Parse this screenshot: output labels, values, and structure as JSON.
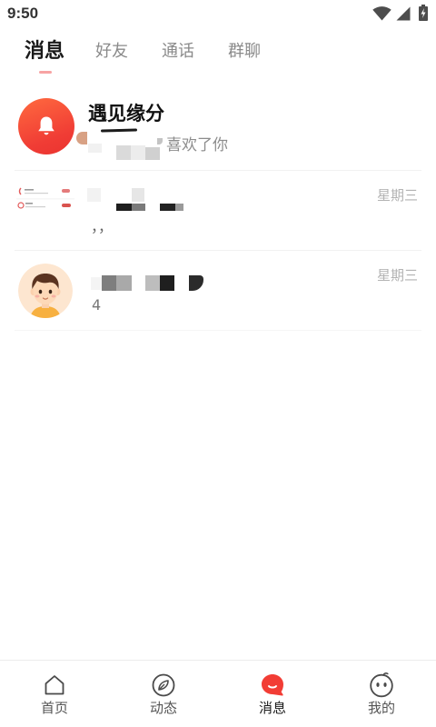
{
  "status_bar": {
    "time": "9:50",
    "icons": [
      "wifi-icon",
      "signal-icon",
      "battery-icon"
    ]
  },
  "tabs": {
    "items": [
      {
        "label": "消息",
        "active": true
      },
      {
        "label": "好友",
        "active": false
      },
      {
        "label": "通话",
        "active": false
      },
      {
        "label": "群聊",
        "active": false
      }
    ]
  },
  "conversations": [
    {
      "title": "遇见缘分",
      "preview": "喜欢了你",
      "avatar_icon": "bell-icon"
    },
    {
      "preview": "，，",
      "time": "星期三",
      "avatar_icon": "screenshot-thumbnail"
    },
    {
      "preview": "4",
      "time": "星期三",
      "avatar_icon": "cartoon-boy-avatar"
    }
  ],
  "bottom_nav": {
    "items": [
      {
        "label": "首页",
        "icon": "home-icon",
        "active": false
      },
      {
        "label": "动态",
        "icon": "compass-icon",
        "active": false
      },
      {
        "label": "消息",
        "icon": "chat-bubble-icon",
        "active": true
      },
      {
        "label": "我的",
        "icon": "face-icon",
        "active": false
      }
    ]
  },
  "colors": {
    "accent": "#f23d35",
    "tab_indicator": "#f7a3a3",
    "text_primary": "#1a1a1a",
    "text_secondary": "#8c8c8c",
    "time_text": "#b3b3b3",
    "divider": "#f1f1f1"
  }
}
